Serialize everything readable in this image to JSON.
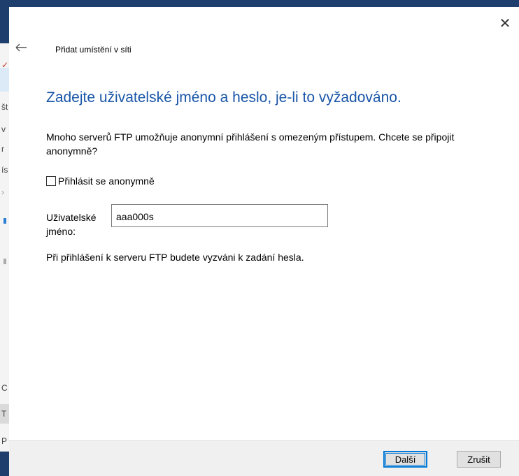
{
  "window": {
    "close_glyph": "✕",
    "back_icon": "back-arrow-icon"
  },
  "nav": {
    "title": "Přidat umístění v síti"
  },
  "main": {
    "heading": "Zadejte uživatelské jméno a heslo, je-li to vyžadováno.",
    "description": "Mnoho serverů FTP umožňuje anonymní přihlášení s omezeným přístupem. Chcete se připojit anonymně?",
    "anonymous_checkbox": {
      "label": "Přihlásit se anonymně",
      "checked": false
    },
    "username": {
      "label": "Uživatelské jméno:",
      "value": "aaa000s"
    },
    "password_note": "Při přihlášení k serveru FTP budete vyzváni k zadání hesla."
  },
  "footer": {
    "next_label": "Další",
    "cancel_label": "Zrušit"
  },
  "background_window": {
    "visible_glyphs": [
      "št",
      "v",
      "r",
      "ís",
      "C",
      "T",
      "P"
    ]
  },
  "colors": {
    "heading": "#1a56a8",
    "accent": "#0078d7",
    "title_band": "#1e3f6e"
  }
}
